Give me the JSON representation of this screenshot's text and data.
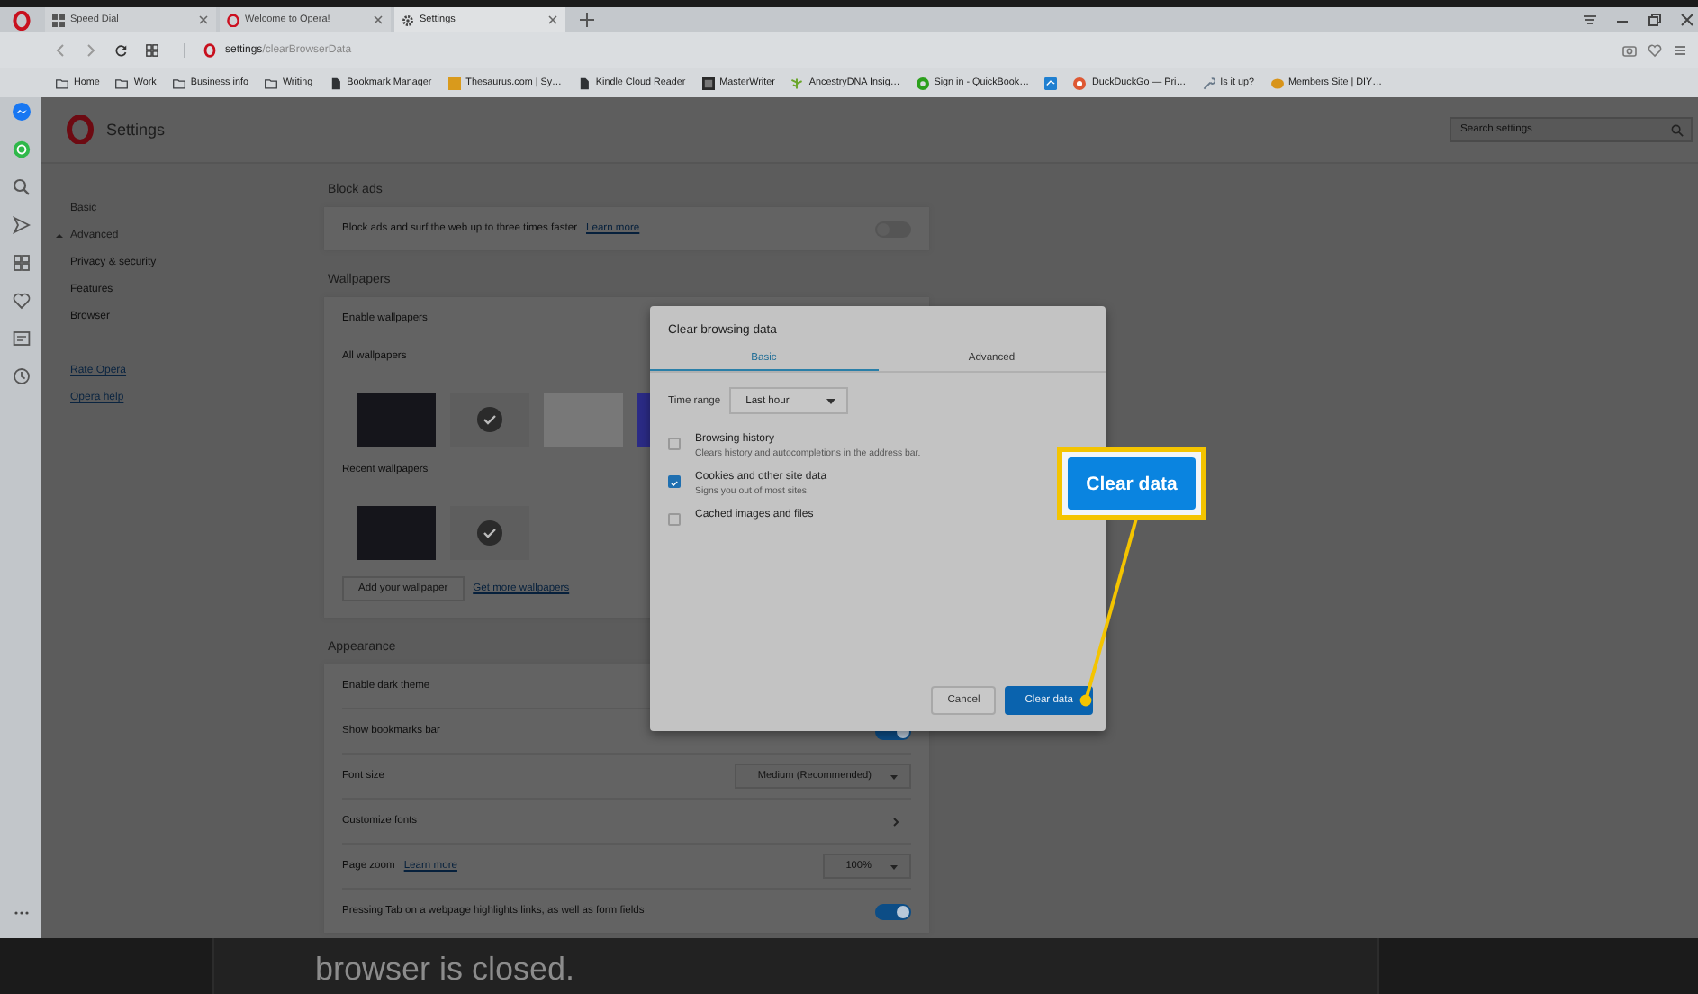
{
  "browser": {
    "tabs": [
      {
        "title": "Speed Dial",
        "selected": false
      },
      {
        "title": "Welcome to Opera!",
        "selected": false
      },
      {
        "title": "Settings",
        "selected": true
      }
    ],
    "address": {
      "host": "settings",
      "path": "/clearBrowserData"
    },
    "bookmarks": [
      {
        "label": "Home"
      },
      {
        "label": "Work"
      },
      {
        "label": "Business info"
      },
      {
        "label": "Writing"
      },
      {
        "label": "Bookmark Manager"
      },
      {
        "label": "Thesaurus.com | Sy…"
      },
      {
        "label": "Kindle Cloud Reader"
      },
      {
        "label": "MasterWriter"
      },
      {
        "label": "AncestryDNA Insig…"
      },
      {
        "label": "Sign in - QuickBook…"
      },
      {
        "label": "DuckDuckGo — Pri…"
      },
      {
        "label": "Is it up?"
      },
      {
        "label": "Members Site | DIY…"
      }
    ]
  },
  "settings": {
    "title": "Settings",
    "search": {
      "placeholder": "Search settings"
    },
    "nav": [
      {
        "label": "Basic",
        "kind": "item"
      },
      {
        "label": "Advanced",
        "kind": "group",
        "expanded": true
      },
      {
        "label": "Privacy & security",
        "kind": "subitem"
      },
      {
        "label": "Features",
        "kind": "subitem"
      },
      {
        "label": "Browser",
        "kind": "subitem"
      },
      {
        "label": "Rate Opera",
        "kind": "link"
      },
      {
        "label": "Opera help",
        "kind": "link"
      }
    ],
    "sections": [
      {
        "heading": "Block ads",
        "rows": [
          {
            "kind": "toggle",
            "label": "Block ads and surf the web up to three times faster",
            "link": "Learn more",
            "on": false
          }
        ]
      },
      {
        "heading": "Wallpapers",
        "rows": [
          {
            "kind": "plain",
            "label": "Enable wallpapers"
          },
          {
            "kind": "gallery",
            "label": "All wallpapers",
            "thumbs": [
              {
                "color": "#15151b",
                "selected": false
              },
              {
                "color": "#5e5e5e",
                "selected": true
              },
              {
                "color": "#787878",
                "selected": false
              },
              {
                "color": "#2b2b86"
              }
            ]
          },
          {
            "kind": "gallery",
            "label": "Recent wallpapers",
            "thumbs": [
              {
                "color": "#15151b",
                "selected": false
              },
              {
                "color": "#5e5e5e",
                "selected": true
              }
            ]
          },
          {
            "kind": "actions",
            "button": "Add your wallpaper",
            "link": "Get more wallpapers"
          }
        ]
      },
      {
        "heading": "Appearance",
        "rows": [
          {
            "kind": "plain",
            "label": "Enable dark theme"
          },
          {
            "kind": "toggle",
            "label": "Show bookmarks bar",
            "on": true
          },
          {
            "kind": "select",
            "label": "Font size",
            "value": "Medium (Recommended)"
          },
          {
            "kind": "arrow",
            "label": "Customize fonts"
          },
          {
            "kind": "select",
            "label": "Page zoom",
            "link": "Learn more",
            "value": "100%"
          },
          {
            "kind": "toggle",
            "label": "Pressing Tab on a webpage highlights links, as well as form fields",
            "on": true
          }
        ]
      }
    ]
  },
  "dialog": {
    "title": "Clear browsing data",
    "tabs": [
      {
        "label": "Basic",
        "selected": true
      },
      {
        "label": "Advanced",
        "selected": false
      }
    ],
    "time_range": {
      "label": "Time range",
      "value": "Last hour"
    },
    "options": [
      {
        "label": "Browsing history",
        "description": "Clears history and autocompletions in the address bar.",
        "checked": false
      },
      {
        "label": "Cookies and other site data",
        "description": "Signs you out of most sites.",
        "checked": true
      },
      {
        "label": "Cached images and files",
        "checked": false
      }
    ],
    "buttons": [
      {
        "label": "Cancel",
        "kind": "secondary"
      },
      {
        "label": "Clear data",
        "kind": "primary"
      }
    ]
  },
  "callout": {
    "label": "Clear data"
  },
  "article": {
    "text": "browser is closed."
  }
}
